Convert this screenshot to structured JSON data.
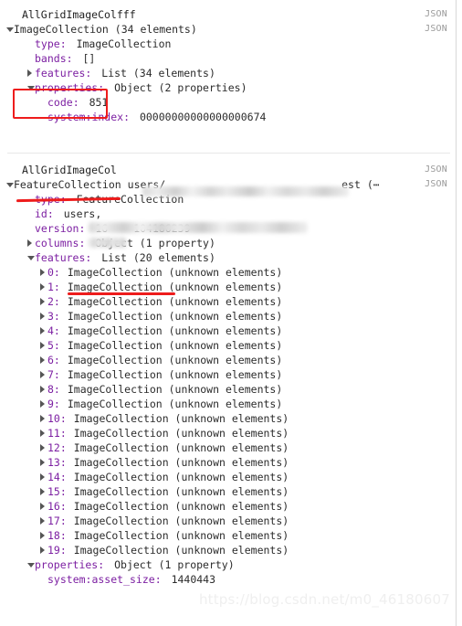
{
  "meta": {
    "json_tag": "JSON"
  },
  "colors": {
    "key": "#7c1fa2",
    "value": "#2b2b2b",
    "annotation_red": "#ee1c1c",
    "json_tag": "#9a9a9a",
    "divider": "#e8e8e8",
    "watermark": "#efefef",
    "background": "#ffffff"
  },
  "sections": [
    {
      "title": "AllGridImageColfff",
      "root": {
        "label": "ImageCollection (34 elements)",
        "state": "expanded"
      },
      "rows": [
        {
          "key": "type:",
          "value": "ImageCollection"
        },
        {
          "key": "bands:",
          "value": "[]"
        },
        {
          "key": "features:",
          "value": "List (34 elements)",
          "state": "collapsed"
        },
        {
          "key": "properties:",
          "value": "Object (2 properties)",
          "state": "expanded"
        },
        {
          "key": "code:",
          "value": "851"
        },
        {
          "key": "system:index:",
          "value": "00000000000000000674"
        }
      ]
    },
    {
      "title": "AllGridImageCol",
      "root": {
        "label_prefix": "FeatureCollection",
        "label_path": "users/",
        "label_suffix": "est (⋯",
        "state": "expanded"
      },
      "rows": [
        {
          "key": "type:",
          "value": "FeatureCollection"
        },
        {
          "key": "id:",
          "value": "users,"
        },
        {
          "key": "version:",
          "value_prefix": "16",
          "value_suffix": "104186239"
        },
        {
          "key": "columns:",
          "value": "Object (1 property)",
          "state": "collapsed"
        },
        {
          "key": "features:",
          "value": "List (20 elements)",
          "state": "expanded"
        }
      ],
      "features_items": [
        {
          "index": "0:",
          "value": "ImageCollection (unknown elements)"
        },
        {
          "index": "1:",
          "value": "ImageCollection (unknown elements)"
        },
        {
          "index": "2:",
          "value": "ImageCollection (unknown elements)"
        },
        {
          "index": "3:",
          "value": "ImageCollection (unknown elements)"
        },
        {
          "index": "4:",
          "value": "ImageCollection (unknown elements)"
        },
        {
          "index": "5:",
          "value": "ImageCollection (unknown elements)"
        },
        {
          "index": "6:",
          "value": "ImageCollection (unknown elements)"
        },
        {
          "index": "7:",
          "value": "ImageCollection (unknown elements)"
        },
        {
          "index": "8:",
          "value": "ImageCollection (unknown elements)"
        },
        {
          "index": "9:",
          "value": "ImageCollection (unknown elements)"
        },
        {
          "index": "10:",
          "value": "ImageCollection (unknown elements)"
        },
        {
          "index": "11:",
          "value": "ImageCollection (unknown elements)"
        },
        {
          "index": "12:",
          "value": "ImageCollection (unknown elements)"
        },
        {
          "index": "13:",
          "value": "ImageCollection (unknown elements)"
        },
        {
          "index": "14:",
          "value": "ImageCollection (unknown elements)"
        },
        {
          "index": "15:",
          "value": "ImageCollection (unknown elements)"
        },
        {
          "index": "16:",
          "value": "ImageCollection (unknown elements)"
        },
        {
          "index": "17:",
          "value": "ImageCollection (unknown elements)"
        },
        {
          "index": "18:",
          "value": "ImageCollection (unknown elements)"
        },
        {
          "index": "19:",
          "value": "ImageCollection (unknown elements)"
        }
      ],
      "tail_rows": [
        {
          "key": "properties:",
          "value": "Object (1 property)",
          "state": "expanded"
        },
        {
          "key": "system:asset_size:",
          "value": "1440443"
        }
      ]
    }
  ],
  "watermark": "https://blog.csdn.net/m0_46180607"
}
